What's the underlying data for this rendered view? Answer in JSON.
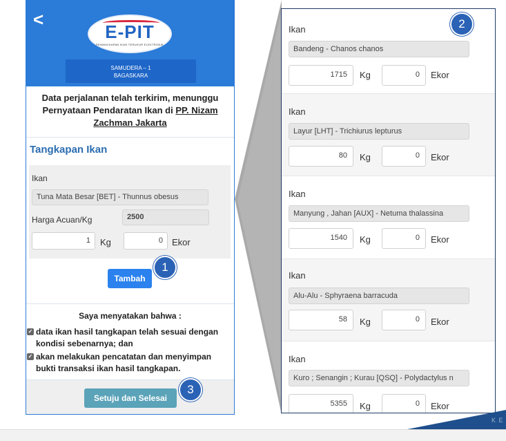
{
  "phone": {
    "back_glyph": "<",
    "logo": {
      "brand": "E-PIT",
      "subtitle": "PENANGKAPAN IKAN TERUKUR ELEKTRONIK"
    },
    "vessel": {
      "line1": "SAMUDERA – 1",
      "line2": "BAGASKARA"
    },
    "notice": {
      "text": "Data perjalanan telah terkirim, menunggu Pernyataan Pendaratan Ikan di",
      "port": "PP. Nizam Zachman Jakarta"
    },
    "section_title": "Tangkapan Ikan",
    "catch_form": {
      "fish_label": "Ikan",
      "fish_value": "Tuna Mata Besar [BET] - Thunnus obesus",
      "price_label": "Harga Acuan/Kg",
      "price_value": "2500",
      "kg_value": "1",
      "kg_unit": "Kg",
      "ekor_value": "0",
      "ekor_unit": "Ekor"
    },
    "add_button": "Tambah",
    "declaration": {
      "title": "Saya menyatakan bahwa :",
      "items": [
        "data ikan hasil tangkapan telah sesuai dengan kondisi sebenarnya; dan",
        "akan melakukan pencatatan dan menyimpan bukti transaksi ikan hasil tangkapan."
      ]
    },
    "finish_button": "Setuju dan Selesai"
  },
  "markers": {
    "m1": "1",
    "m2": "2",
    "m3": "3"
  },
  "zoom_list": {
    "items": [
      {
        "label": "Ikan",
        "fish": "Bandeng - Chanos chanos",
        "kg": "1715",
        "kg_unit": "Kg",
        "ekor": "0",
        "ekor_unit": "Ekor"
      },
      {
        "label": "Ikan",
        "fish": "Layur [LHT] - Trichiurus lepturus",
        "kg": "80",
        "kg_unit": "Kg",
        "ekor": "0",
        "ekor_unit": "Ekor"
      },
      {
        "label": "Ikan",
        "fish": "Manyung , Jahan [AUX] - Netuma thalassina",
        "kg": "1540",
        "kg_unit": "Kg",
        "ekor": "0",
        "ekor_unit": "Ekor"
      },
      {
        "label": "Ikan",
        "fish": "Alu-Alu - Sphyraena barracuda",
        "kg": "58",
        "kg_unit": "Kg",
        "ekor": "0",
        "ekor_unit": "Ekor"
      },
      {
        "label": "Ikan",
        "fish": "Kuro ; Senangin ; Kurau [QSQ] - Polydactylus n",
        "kg": "5355",
        "kg_unit": "Kg",
        "ekor": "0",
        "ekor_unit": "Ekor"
      }
    ]
  },
  "corner_text": "K E",
  "colors": {
    "primary": "#2b7bd8",
    "button": "#2b82ee",
    "finish": "#5ba3b8",
    "marker": "#2a62b5"
  }
}
